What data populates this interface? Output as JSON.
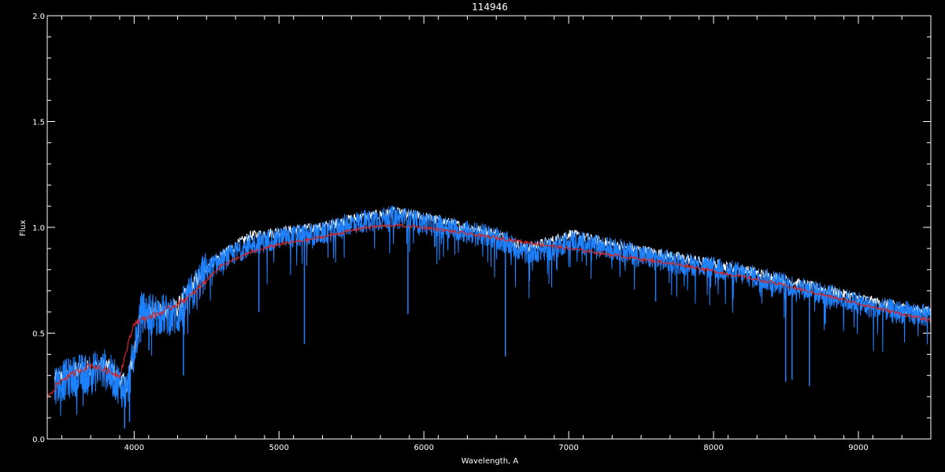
{
  "chart_data": {
    "type": "line",
    "title": "114946",
    "xlabel": "Wavelength, A",
    "ylabel": "Flux",
    "xlim": [
      3400,
      9500
    ],
    "ylim": [
      0.0,
      2.0
    ],
    "x_ticks": [
      4000,
      5000,
      6000,
      7000,
      8000,
      9000
    ],
    "x_tick_labels": [
      "4000",
      "5000",
      "6000",
      "7000",
      "8000",
      "9000"
    ],
    "y_ticks": [
      0.0,
      0.5,
      1.0,
      1.5,
      2.0
    ],
    "y_tick_labels": [
      "0.0",
      "0.5",
      "1.0",
      "1.5",
      "2.0"
    ],
    "grid": false,
    "background": "#000000",
    "axis_color": "#ffffff",
    "series": [
      {
        "color": "#ffffff",
        "x": [
          3450,
          3600,
          3800,
          3950,
          4050,
          4300,
          4500,
          4800,
          5000,
          5300,
          5500,
          5800,
          6000,
          6300,
          6500,
          6700,
          6900,
          7000,
          7300,
          7600,
          7900,
          8200,
          8500,
          8800,
          9100,
          9300,
          9500
        ],
        "y": [
          0.28,
          0.32,
          0.35,
          0.25,
          0.6,
          0.62,
          0.82,
          0.96,
          0.98,
          1.0,
          1.04,
          1.07,
          1.05,
          1.0,
          0.97,
          0.9,
          0.94,
          0.97,
          0.92,
          0.88,
          0.84,
          0.8,
          0.75,
          0.7,
          0.65,
          0.62,
          0.6
        ]
      },
      {
        "color": "#1e82ff",
        "x": [
          3450,
          3600,
          3800,
          3950,
          4050,
          4300,
          4500,
          4800,
          5000,
          5300,
          5500,
          5800,
          6000,
          6300,
          6500,
          6700,
          6900,
          7000,
          7300,
          7600,
          7900,
          8200,
          8500,
          8800,
          9100,
          9300,
          9500
        ],
        "y": [
          0.26,
          0.3,
          0.33,
          0.22,
          0.6,
          0.58,
          0.8,
          0.92,
          0.95,
          0.97,
          1.02,
          1.05,
          1.02,
          0.98,
          0.95,
          0.88,
          0.9,
          0.94,
          0.9,
          0.85,
          0.82,
          0.78,
          0.73,
          0.68,
          0.62,
          0.6,
          0.58
        ]
      },
      {
        "color": "#d02828",
        "x": [
          3400,
          3500,
          3700,
          3900,
          4000,
          4200,
          4400,
          4600,
          4800,
          5000,
          5200,
          5400,
          5600,
          5800,
          6000,
          6300,
          6600,
          6900,
          7200,
          7500,
          7800,
          8100,
          8400,
          8700,
          9000,
          9300,
          9500
        ],
        "y": [
          0.2,
          0.28,
          0.35,
          0.3,
          0.55,
          0.6,
          0.68,
          0.82,
          0.88,
          0.92,
          0.94,
          0.97,
          1.0,
          1.01,
          1.0,
          0.97,
          0.94,
          0.91,
          0.88,
          0.85,
          0.82,
          0.78,
          0.74,
          0.69,
          0.64,
          0.59,
          0.56
        ]
      }
    ],
    "absorption_lines": [
      {
        "x": 3934,
        "y": 0.05
      },
      {
        "x": 3968,
        "y": 0.08
      },
      {
        "x": 4102,
        "y": 0.42
      },
      {
        "x": 4340,
        "y": 0.3
      },
      {
        "x": 4861,
        "y": 0.6
      },
      {
        "x": 5175,
        "y": 0.45
      },
      {
        "x": 5890,
        "y": 0.59
      },
      {
        "x": 6563,
        "y": 0.39
      },
      {
        "x": 7600,
        "y": 0.65
      },
      {
        "x": 8498,
        "y": 0.27
      },
      {
        "x": 8542,
        "y": 0.28
      },
      {
        "x": 8662,
        "y": 0.25
      }
    ]
  }
}
